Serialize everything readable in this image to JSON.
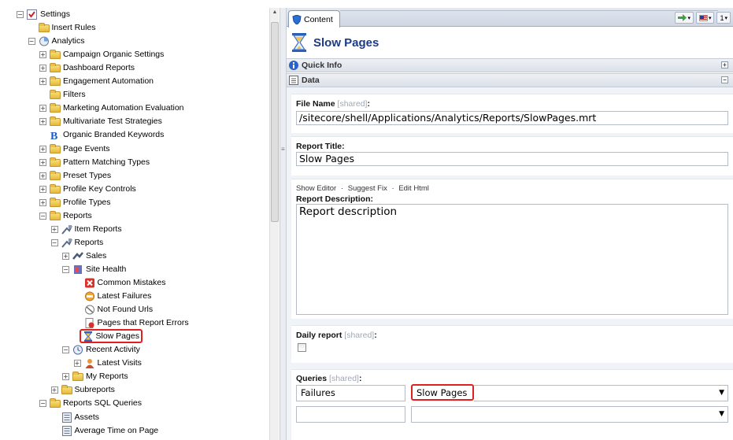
{
  "tree": {
    "items": [
      {
        "label": "Settings",
        "level": 0,
        "expander": "minus",
        "icon": "settings-icon"
      },
      {
        "label": "Insert Rules",
        "level": 1,
        "expander": "",
        "icon": "folder-icon"
      },
      {
        "label": "Analytics",
        "level": 1,
        "expander": "minus",
        "icon": "analytics-icon"
      },
      {
        "label": "Campaign Organic Settings",
        "level": 2,
        "expander": "plus",
        "icon": "folder-icon"
      },
      {
        "label": "Dashboard Reports",
        "level": 2,
        "expander": "plus",
        "icon": "folder-icon"
      },
      {
        "label": "Engagement Automation",
        "level": 2,
        "expander": "plus",
        "icon": "folder-icon"
      },
      {
        "label": "Filters",
        "level": 2,
        "expander": "",
        "icon": "folder-icon"
      },
      {
        "label": "Marketing Automation Evaluation",
        "level": 2,
        "expander": "plus",
        "icon": "folder-icon"
      },
      {
        "label": "Multivariate Test Strategies",
        "level": 2,
        "expander": "plus",
        "icon": "folder-icon"
      },
      {
        "label": "Organic Branded Keywords",
        "level": 2,
        "expander": "",
        "icon": "b-icon"
      },
      {
        "label": "Page Events",
        "level": 2,
        "expander": "plus",
        "icon": "folder-icon"
      },
      {
        "label": "Pattern Matching Types",
        "level": 2,
        "expander": "plus",
        "icon": "folder-icon"
      },
      {
        "label": "Preset Types",
        "level": 2,
        "expander": "plus",
        "icon": "folder-icon"
      },
      {
        "label": "Profile Key Controls",
        "level": 2,
        "expander": "plus",
        "icon": "folder-icon"
      },
      {
        "label": "Profile Types",
        "level": 2,
        "expander": "plus",
        "icon": "folder-icon"
      },
      {
        "label": "Reports",
        "level": 2,
        "expander": "minus",
        "icon": "folder-icon"
      },
      {
        "label": "Item Reports",
        "level": 3,
        "expander": "plus",
        "icon": "report-icon"
      },
      {
        "label": "Reports",
        "level": 3,
        "expander": "minus",
        "icon": "report-icon"
      },
      {
        "label": "Sales",
        "level": 4,
        "expander": "plus",
        "icon": "sales-icon"
      },
      {
        "label": "Site Health",
        "level": 4,
        "expander": "minus",
        "icon": "site-health-icon"
      },
      {
        "label": "Common Mistakes",
        "level": 5,
        "expander": "",
        "icon": "error-icon"
      },
      {
        "label": "Latest Failures",
        "level": 5,
        "expander": "",
        "icon": "failure-icon"
      },
      {
        "label": "Not Found Urls",
        "level": 5,
        "expander": "",
        "icon": "not-found-icon"
      },
      {
        "label": "Pages that Report Errors",
        "level": 5,
        "expander": "",
        "icon": "page-error-icon"
      },
      {
        "label": "Slow Pages",
        "level": 5,
        "expander": "",
        "icon": "hourglass-icon",
        "highlighted": true
      },
      {
        "label": "Recent Activity",
        "level": 4,
        "expander": "minus",
        "icon": "clock-icon"
      },
      {
        "label": "Latest Visits",
        "level": 5,
        "expander": "plus",
        "icon": "user-icon"
      },
      {
        "label": "My Reports",
        "level": 4,
        "expander": "plus",
        "icon": "folder-icon"
      },
      {
        "label": "Subreports",
        "level": 3,
        "expander": "plus",
        "icon": "folder-icon"
      },
      {
        "label": "Reports SQL Queries",
        "level": 2,
        "expander": "minus",
        "icon": "folder-icon"
      },
      {
        "label": "Assets",
        "level": 3,
        "expander": "",
        "icon": "sql-icon"
      },
      {
        "label": "Average Time on Page",
        "level": 3,
        "expander": "",
        "icon": "sql-icon"
      }
    ]
  },
  "content": {
    "tab_label": "Content",
    "tab_tools_lang": "1",
    "header_title": "Slow Pages",
    "quick_info_label": "Quick Info",
    "data_label": "Data",
    "file_name_label": "File Name",
    "shared_tag": "[shared]",
    "colon": ":",
    "file_name_value": "/sitecore/shell/Applications/Analytics/Reports/SlowPages.mrt",
    "report_title_label": "Report Title:",
    "report_title_value": "Slow Pages",
    "show_editor": "Show Editor",
    "suggest_fix": "Suggest Fix",
    "edit_html": "Edit Html",
    "link_sep": "·",
    "report_description_label": "Report Description:",
    "report_description_value": "Report description",
    "daily_report_label": "Daily report",
    "queries_label": "Queries",
    "query_rows": [
      {
        "name": "Failures",
        "value": "Slow Pages",
        "highlighted": true
      },
      {
        "name": "",
        "value": ""
      }
    ]
  },
  "colors": {
    "accent": "#1d3b84",
    "highlight": "#e0201e"
  }
}
